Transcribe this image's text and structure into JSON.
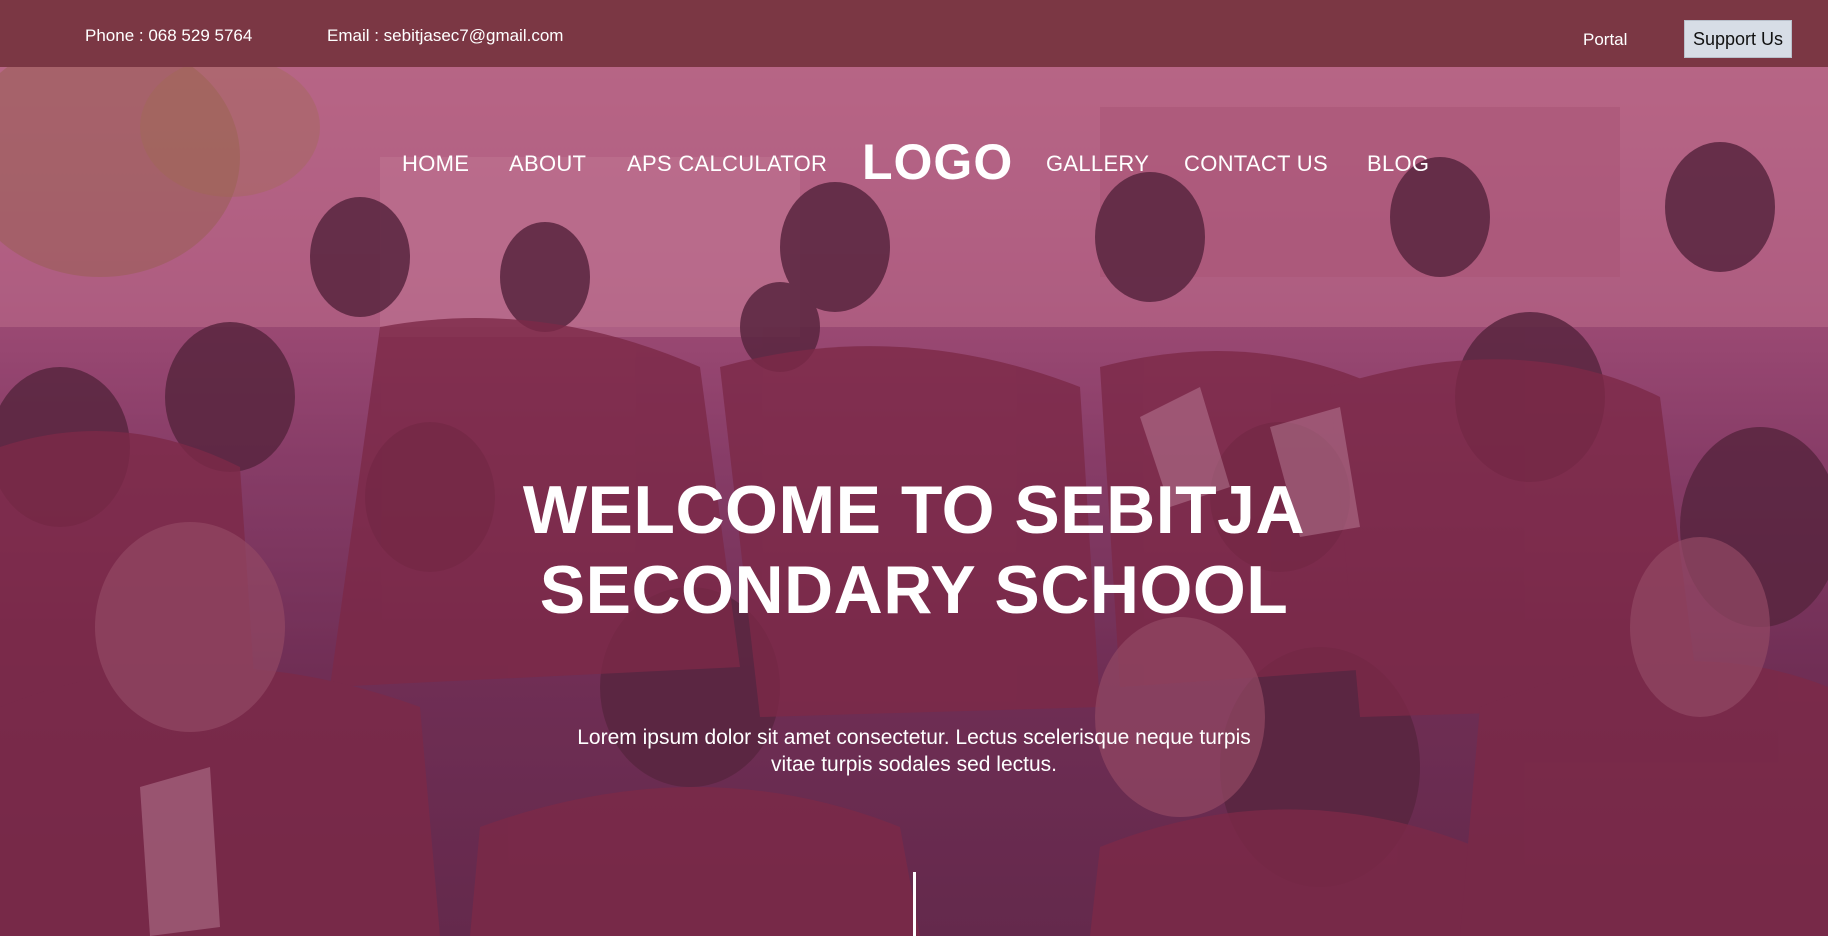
{
  "topbar": {
    "phone": "Phone : 068 529 5764",
    "email": "Email : sebitjasec7@gmail.com",
    "portal_label": "Portal",
    "support_label": "Support Us"
  },
  "nav": {
    "items": [
      "HOME",
      "ABOUT",
      "APS CALCULATOR",
      "GALLERY",
      "CONTACT US",
      "BLOG"
    ],
    "logo": "LOGO"
  },
  "hero": {
    "title_line1": "WELCOME TO SEBITJA",
    "title_line2": "SECONDARY SCHOOL",
    "subtitle": "Lorem ipsum dolor sit amet consectetur. Lectus scelerisque neque turpis vitae turpis sodales sed lectus."
  },
  "colors": {
    "topbar": "#7b3744",
    "support_button": "#d7dde6",
    "overlay": "#aa4678"
  }
}
